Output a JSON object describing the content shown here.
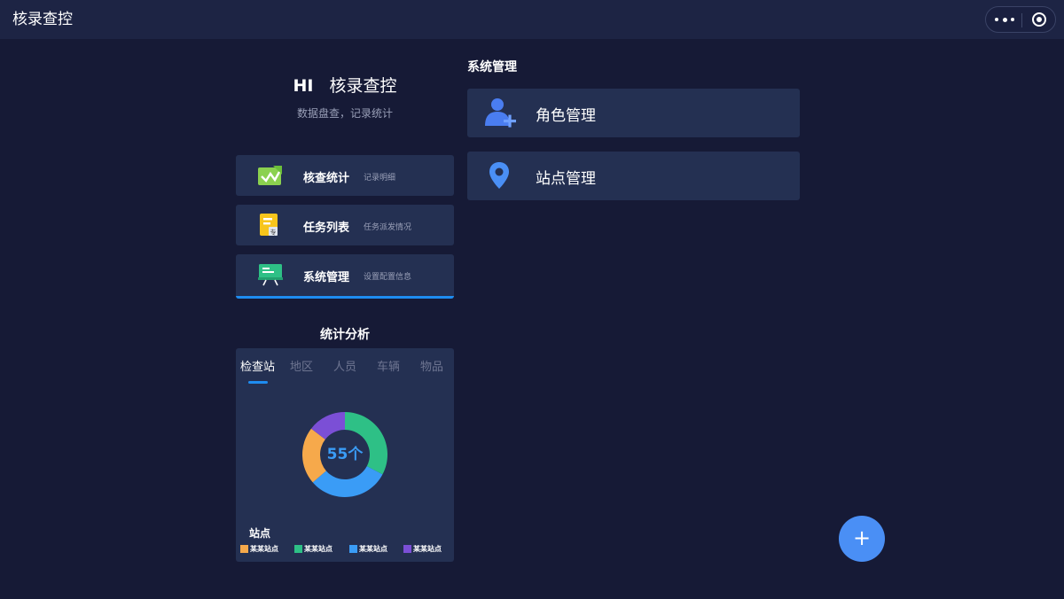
{
  "app": {
    "title": "核录查控"
  },
  "greeting": {
    "hi": "HI",
    "name": "核录查控",
    "subtitle": "数据盘查，记录统计"
  },
  "menu": [
    {
      "name": "核查统计",
      "desc": "记录明细",
      "icon": "checklist-icon",
      "active": false
    },
    {
      "name": "任务列表",
      "desc": "任务派发情况",
      "icon": "task-doc-icon",
      "active": false
    },
    {
      "name": "系统管理",
      "desc": "设置配置信息",
      "icon": "system-board-icon",
      "active": true
    }
  ],
  "stats": {
    "title": "统计分析",
    "tabs": [
      "检查站",
      "地区",
      "人员",
      "车辆",
      "物品"
    ],
    "active_tab": 0,
    "center_label": "55个",
    "legend_title": "站点"
  },
  "chart_data": {
    "type": "pie",
    "center_text": "55个",
    "slices": [
      {
        "name": "某某站点",
        "value": 12,
        "color": "#f6a94b"
      },
      {
        "name": "某某站点",
        "value": 18,
        "color": "#2ec086"
      },
      {
        "name": "某某站点",
        "value": 17,
        "color": "#3a9cf6"
      },
      {
        "name": "某某站点",
        "value": 8,
        "color": "#7b4fd6"
      }
    ],
    "draw_order": [
      1,
      2,
      0,
      3
    ],
    "legend_title": "站点",
    "legend_placement": "bottom"
  },
  "system": {
    "heading": "系统管理",
    "items": [
      {
        "name": "角色管理",
        "icon": "user-add-icon"
      },
      {
        "name": "站点管理",
        "icon": "location-pin-icon"
      }
    ]
  },
  "fab": {
    "label": "+"
  },
  "colors": {
    "accent": "#1e8cf0",
    "background": "#161a36",
    "card": "#243052"
  }
}
